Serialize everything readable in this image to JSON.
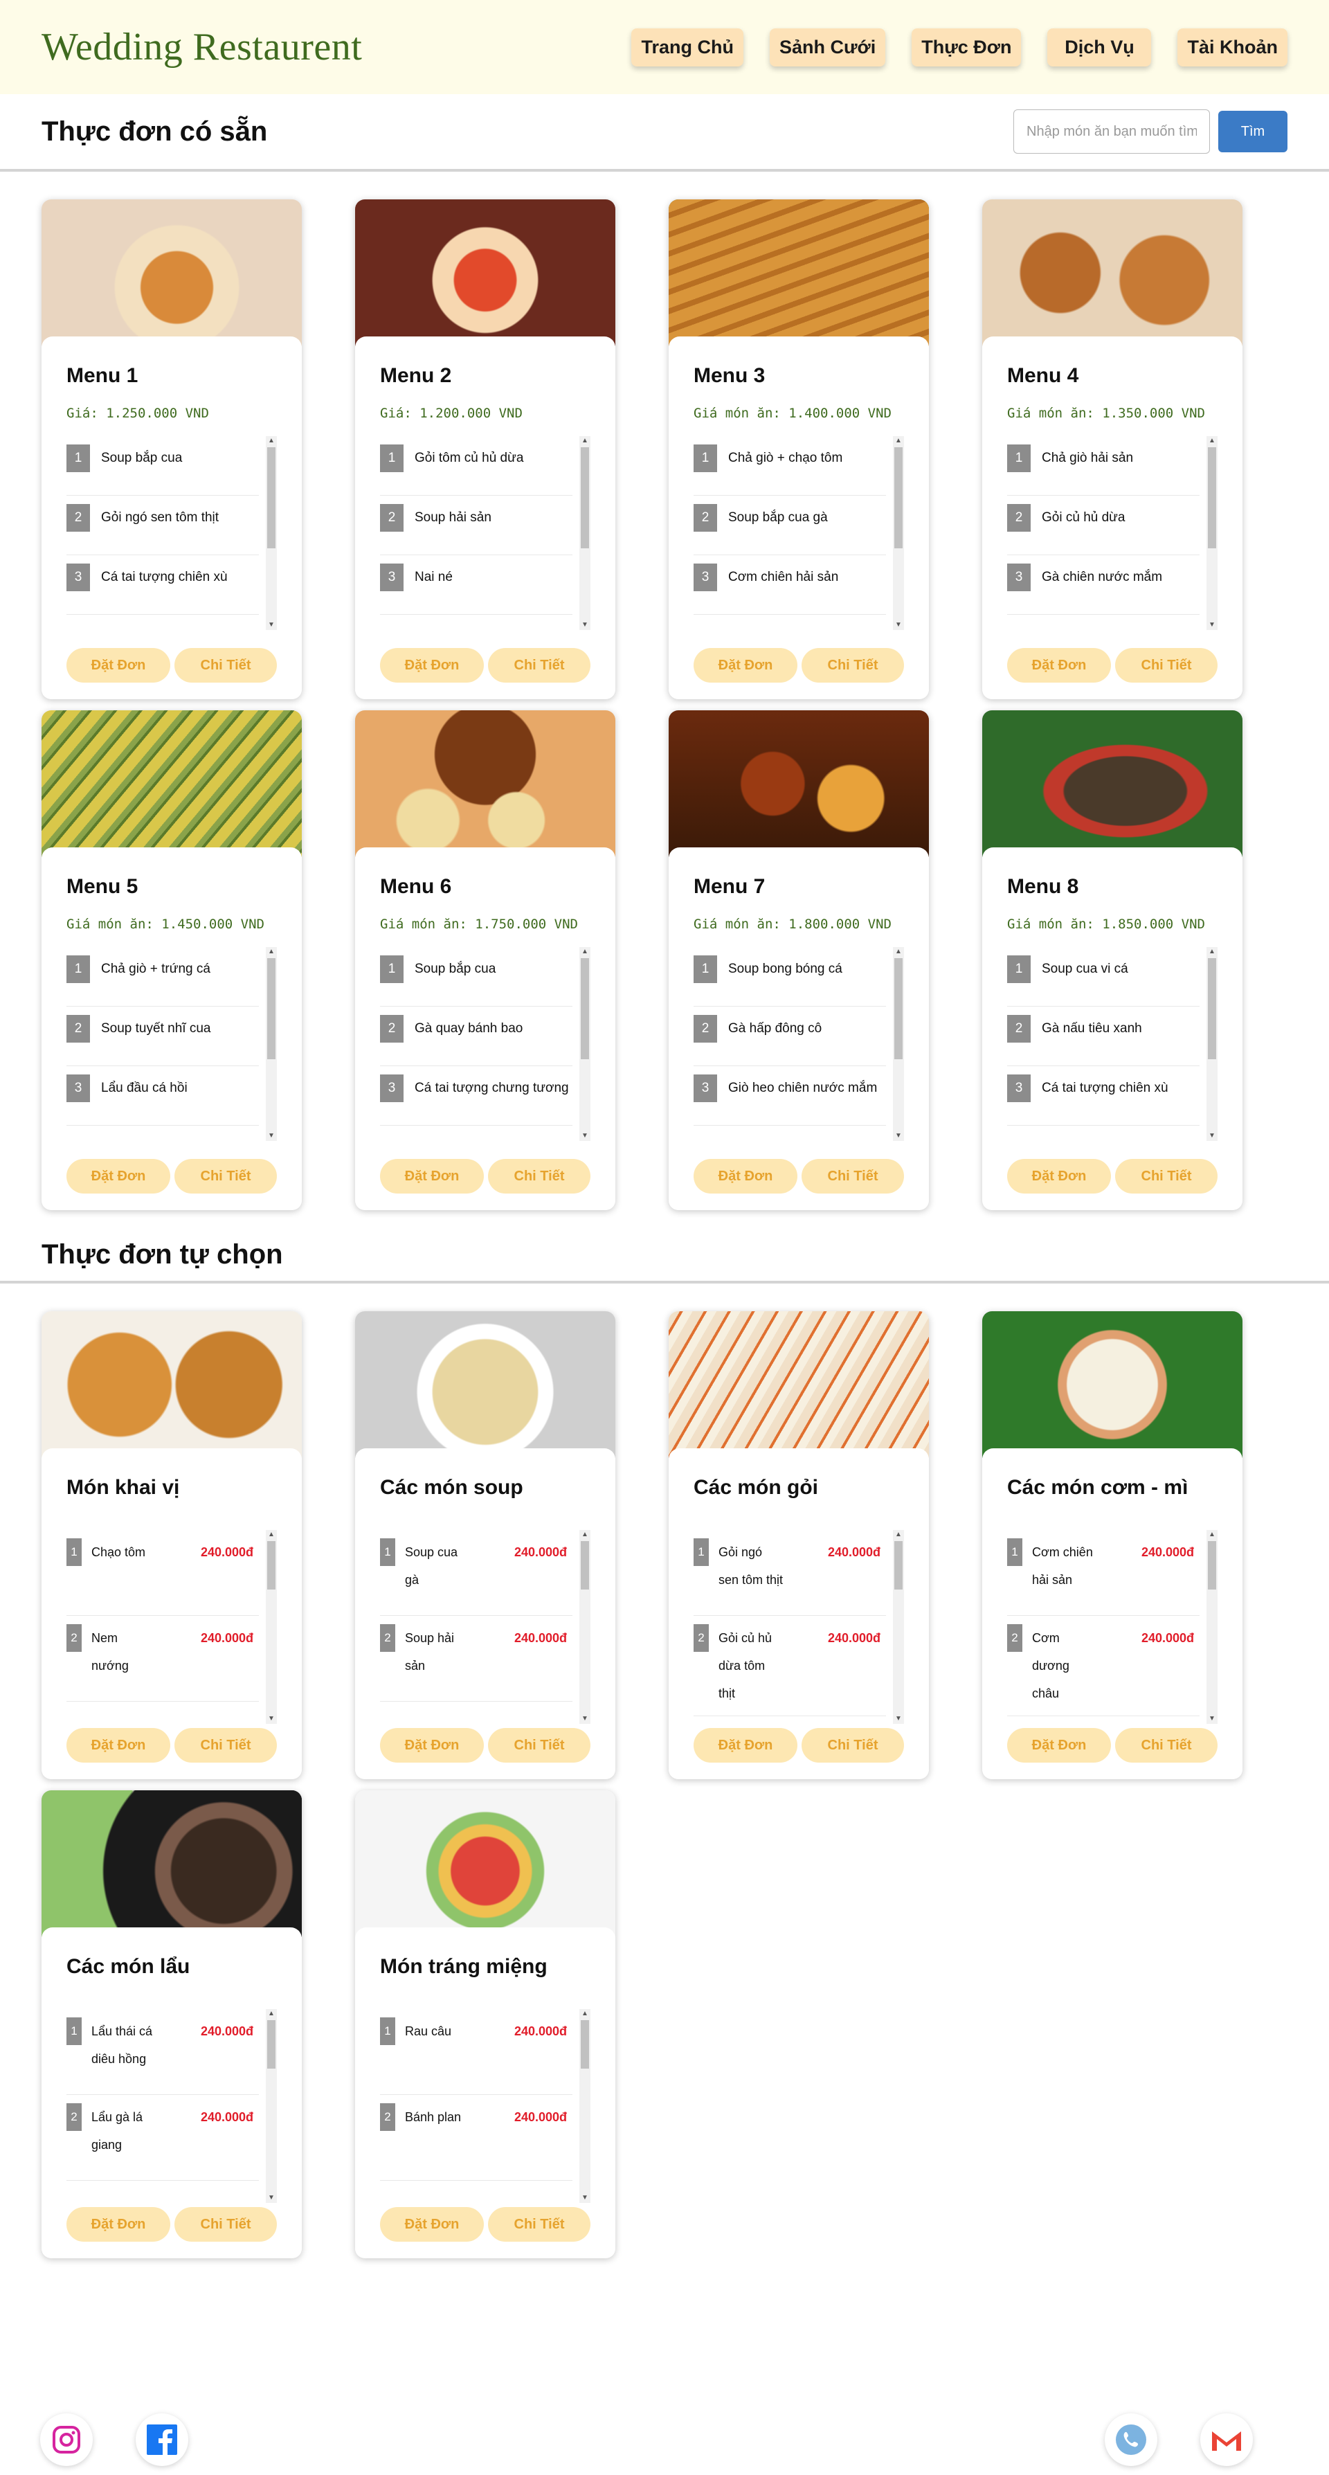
{
  "header": {
    "brand": "Wedding Restaurent",
    "nav": [
      "Trang Chủ",
      "Sảnh Cưới",
      "Thực Đơn",
      "Dịch Vụ",
      "Tài Khoản"
    ]
  },
  "section1": {
    "title": "Thực đơn có sẵn",
    "search_placeholder": "Nhập món ăn bạn muốn tìm",
    "search_button": "Tìm"
  },
  "buttons": {
    "order": "Đặt Đơn",
    "detail": "Chi Tiết"
  },
  "menus": [
    {
      "title": "Menu 1",
      "price": "Giá: 1.250.000 VND",
      "dishes": [
        "Soup bắp cua",
        "Gỏi ngó sen tôm thịt",
        "Cá tai tượng chiên xù"
      ]
    },
    {
      "title": "Menu 2",
      "price": "Giá: 1.200.000 VND",
      "dishes": [
        "Gỏi tôm củ hủ dừa",
        "Soup hải sản",
        "Nai né"
      ]
    },
    {
      "title": "Menu 3",
      "price": "Giá món ăn: 1.400.000 VND",
      "dishes": [
        "Chả giò + chạo tôm",
        "Soup bắp cua gà",
        "Cơm chiên hải sản"
      ]
    },
    {
      "title": "Menu 4",
      "price": "Giá món ăn: 1.350.000 VND",
      "dishes": [
        "Chả giò hải sản",
        "Gỏi củ hủ dừa",
        "Gà chiên nước mắm"
      ]
    },
    {
      "title": "Menu 5",
      "price": "Giá món ăn: 1.450.000 VND",
      "dishes": [
        "Chả giò + trứng cá",
        "Soup tuyết nhĩ cua",
        "Lẩu đầu cá hồi"
      ]
    },
    {
      "title": "Menu 6",
      "price": "Giá món ăn: 1.750.000 VND",
      "dishes": [
        "Soup bắp cua",
        "Gà quay bánh bao",
        "Cá tai tượng chưng tương"
      ]
    },
    {
      "title": "Menu 7",
      "price": "Giá món ăn: 1.800.000 VND",
      "dishes": [
        "Soup bong bóng cá",
        "Gà hấp đông cô",
        "Giò heo chiên nước mắm"
      ]
    },
    {
      "title": "Menu 8",
      "price": "Giá món ăn: 1.850.000 VND",
      "dishes": [
        "Soup cua vi cá",
        "Gà nấu tiêu xanh",
        "Cá tai tượng chiên xù"
      ]
    }
  ],
  "section2": {
    "title": "Thực đơn tự chọn"
  },
  "custom": [
    {
      "title": "Món khai vị",
      "dishes": [
        {
          "name": "Chạo tôm",
          "price": "240.000đ"
        },
        {
          "name": "Nem nướng",
          "price": "240.000đ"
        }
      ]
    },
    {
      "title": "Các món soup",
      "dishes": [
        {
          "name": "Soup cua gà",
          "price": "240.000đ"
        },
        {
          "name": "Soup hải sản",
          "price": "240.000đ"
        }
      ]
    },
    {
      "title": "Các món gỏi",
      "dishes": [
        {
          "name": "Gỏi ngó sen tôm thịt",
          "price": "240.000đ"
        },
        {
          "name": "Gỏi củ hủ dừa tôm thịt",
          "price": "240.000đ"
        }
      ]
    },
    {
      "title": "Các món cơm - mì",
      "dishes": [
        {
          "name": "Cơm chiên hải sản",
          "price": "240.000đ"
        },
        {
          "name": "Cơm dương châu",
          "price": "240.000đ"
        }
      ]
    },
    {
      "title": "Các món lẩu",
      "dishes": [
        {
          "name": "Lẩu thái cá diêu hồng",
          "price": "240.000đ"
        },
        {
          "name": "Lẩu gà lá giang",
          "price": "240.000đ"
        }
      ]
    },
    {
      "title": "Món tráng miệng",
      "dishes": [
        {
          "name": "Rau câu",
          "price": "240.000đ"
        },
        {
          "name": "Bánh plan",
          "price": "240.000đ"
        }
      ]
    }
  ],
  "footer": {
    "icons": [
      "instagram-icon",
      "facebook-icon",
      "phone-icon",
      "gmail-icon"
    ]
  }
}
